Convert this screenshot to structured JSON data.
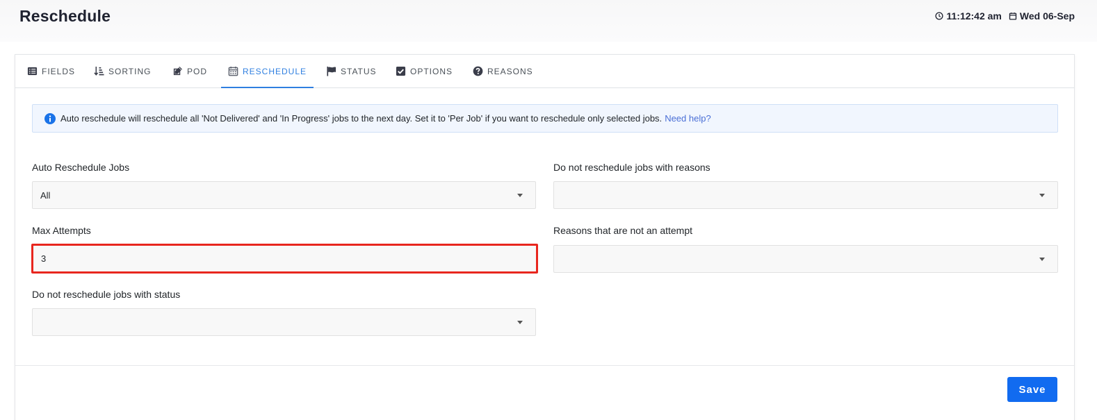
{
  "header": {
    "title": "Reschedule",
    "time": "11:12:42 am",
    "date": "Wed 06-Sep"
  },
  "tabs": [
    {
      "label": "FIELDS",
      "icon": "list-icon",
      "active": false
    },
    {
      "label": "SORTING",
      "icon": "sort-icon",
      "active": false
    },
    {
      "label": "POD",
      "icon": "edit-icon",
      "active": false
    },
    {
      "label": "RESCHEDULE",
      "icon": "calendar-icon",
      "active": true
    },
    {
      "label": "STATUS",
      "icon": "flag-icon",
      "active": false
    },
    {
      "label": "OPTIONS",
      "icon": "checkbox-icon",
      "active": false
    },
    {
      "label": "REASONS",
      "icon": "question-circle-icon",
      "active": false
    }
  ],
  "alert": {
    "text": "Auto reschedule will reschedule all 'Not Delivered' and 'In Progress' jobs to the next day. Set it to 'Per Job' if you want to reschedule only selected jobs.",
    "link": "Need help?"
  },
  "form": {
    "auto_reschedule": {
      "label": "Auto Reschedule Jobs",
      "value": "All"
    },
    "max_attempts": {
      "label": "Max Attempts",
      "value": "3"
    },
    "exclude_status": {
      "label": "Do not reschedule jobs with status",
      "value": ""
    },
    "exclude_reasons": {
      "label": "Do not reschedule jobs with reasons",
      "value": ""
    },
    "non_attempt_reasons": {
      "label": "Reasons that are not an attempt",
      "value": ""
    }
  },
  "actions": {
    "save_label": "Save"
  },
  "colors": {
    "accent": "#2f7fe0",
    "save_button": "#116bf0",
    "highlight_border": "#e8261e",
    "alert_bg": "#f1f6fe",
    "link": "#4a6fd6"
  }
}
